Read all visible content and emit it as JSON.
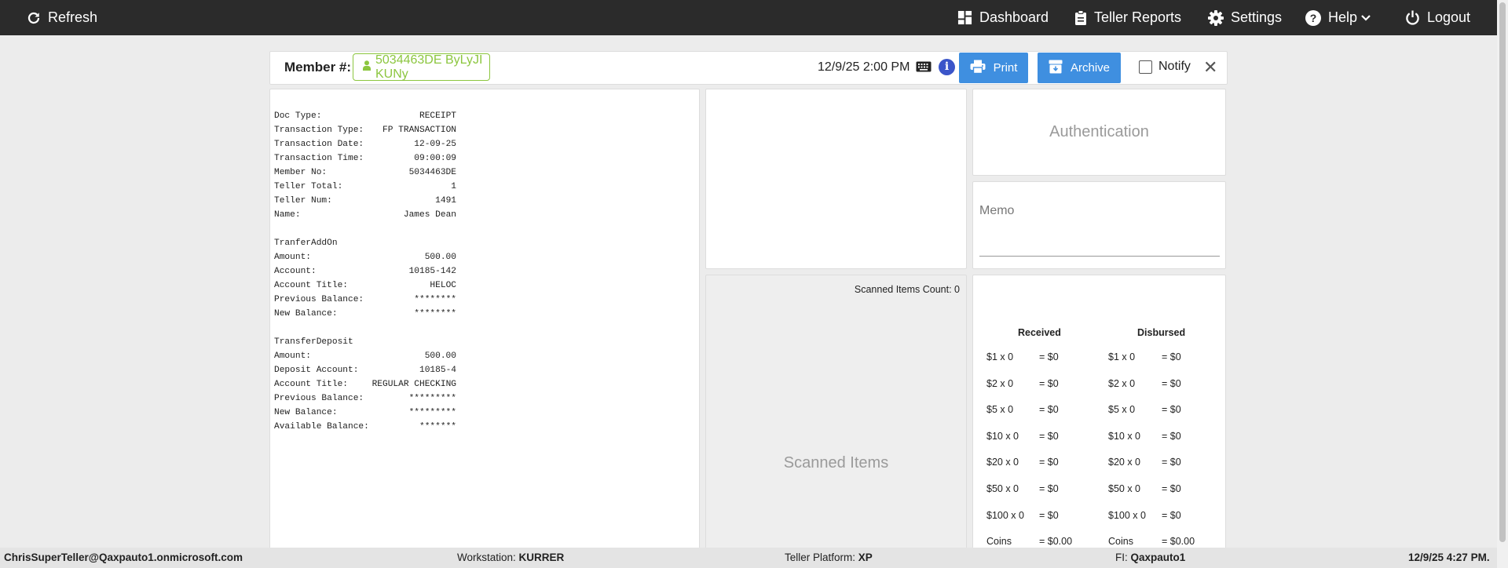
{
  "topbar": {
    "refresh_label": "Refresh",
    "dashboard_label": "Dashboard",
    "reports_label": "Teller Reports",
    "settings_label": "Settings",
    "help_label": "Help",
    "logout_label": "Logout"
  },
  "header": {
    "member_label": "Member #:",
    "member_value": "5034463DE ByLyJI KUNy",
    "datetime": "12/9/25 2:00 PM",
    "print_label": "Print",
    "archive_label": "Archive",
    "notify_label": "Notify",
    "notify_checked": false
  },
  "receipt": {
    "rows1": [
      {
        "label": "Doc Type:",
        "value": "RECEIPT"
      },
      {
        "label": "Transaction Type:",
        "value": "FP TRANSACTION"
      },
      {
        "label": "Transaction Date:",
        "value": "12-09-25"
      },
      {
        "label": "Transaction Time:",
        "value": "09:00:09"
      },
      {
        "label": "Member No:",
        "value": "5034463DE"
      },
      {
        "label": "Teller Total:",
        "value": "1"
      },
      {
        "label": "Teller Num:",
        "value": "1491"
      },
      {
        "label": "Name:",
        "value": "James Dean"
      }
    ],
    "section2_title": "TranferAddOn",
    "rows2": [
      {
        "label": "Amount:",
        "value": "500.00"
      },
      {
        "label": "Account:",
        "value": "10185-142"
      },
      {
        "label": "Account Title:",
        "value": "HELOC"
      },
      {
        "label": "Previous Balance:",
        "value": "********"
      },
      {
        "label": "New Balance:",
        "value": "********"
      }
    ],
    "section3_title": "TransferDeposit",
    "rows3": [
      {
        "label": "Amount:",
        "value": "500.00"
      },
      {
        "label": "Deposit Account:",
        "value": "10185-4"
      },
      {
        "label": "Account Title:",
        "value": "REGULAR CHECKING"
      },
      {
        "label": "Previous Balance:",
        "value": "*********"
      },
      {
        "label": "New Balance:",
        "value": "*********"
      },
      {
        "label": "Available Balance:",
        "value": "*******"
      }
    ]
  },
  "auth": {
    "title": "Authentication"
  },
  "memo": {
    "label": "Memo"
  },
  "scanned": {
    "count_label": "Scanned Items Count: 0",
    "title": "Scanned Items"
  },
  "cash": {
    "received_label": "Received",
    "disbursed_label": "Disbursed",
    "received": [
      {
        "denom": "$1 x 0",
        "total": "= $0"
      },
      {
        "denom": "$2 x 0",
        "total": "= $0"
      },
      {
        "denom": "$5 x 0",
        "total": "= $0"
      },
      {
        "denom": "$10 x 0",
        "total": "= $0"
      },
      {
        "denom": "$20 x 0",
        "total": "= $0"
      },
      {
        "denom": "$50 x 0",
        "total": "= $0"
      },
      {
        "denom": "$100 x 0",
        "total": "= $0"
      },
      {
        "denom": "Coins",
        "total": "= $0.00"
      }
    ],
    "disbursed": [
      {
        "denom": "$1 x 0",
        "total": "= $0"
      },
      {
        "denom": "$2 x 0",
        "total": "= $0"
      },
      {
        "denom": "$5 x 0",
        "total": "= $0"
      },
      {
        "denom": "$10 x 0",
        "total": "= $0"
      },
      {
        "denom": "$20 x 0",
        "total": "= $0"
      },
      {
        "denom": "$50 x 0",
        "total": "= $0"
      },
      {
        "denom": "$100 x 0",
        "total": "= $0"
      },
      {
        "denom": "Coins",
        "total": "= $0.00"
      }
    ]
  },
  "footer": {
    "user": "ChrisSuperTeller@Qaxpauto1.onmicrosoft.com",
    "workstation_label": "Workstation:",
    "workstation": "KURRER",
    "platform_label": "Teller Platform:",
    "platform": "XP",
    "fi_label": "FI:",
    "fi": "Qaxpauto1",
    "datetime": "12/9/25 4:27 PM."
  },
  "colors": {
    "topbar": "#2b2b2b",
    "accent_blue": "#3f8fe0",
    "member_green": "#8cc63f",
    "info_blue": "#3b55c9"
  },
  "icons": [
    "refresh-icon",
    "dashboard-icon",
    "clipboard-icon",
    "gear-icon",
    "help-icon",
    "chevron-down-icon",
    "power-icon",
    "user-icon",
    "keyboard-icon",
    "info-icon",
    "printer-icon",
    "archive-icon",
    "close-icon"
  ]
}
